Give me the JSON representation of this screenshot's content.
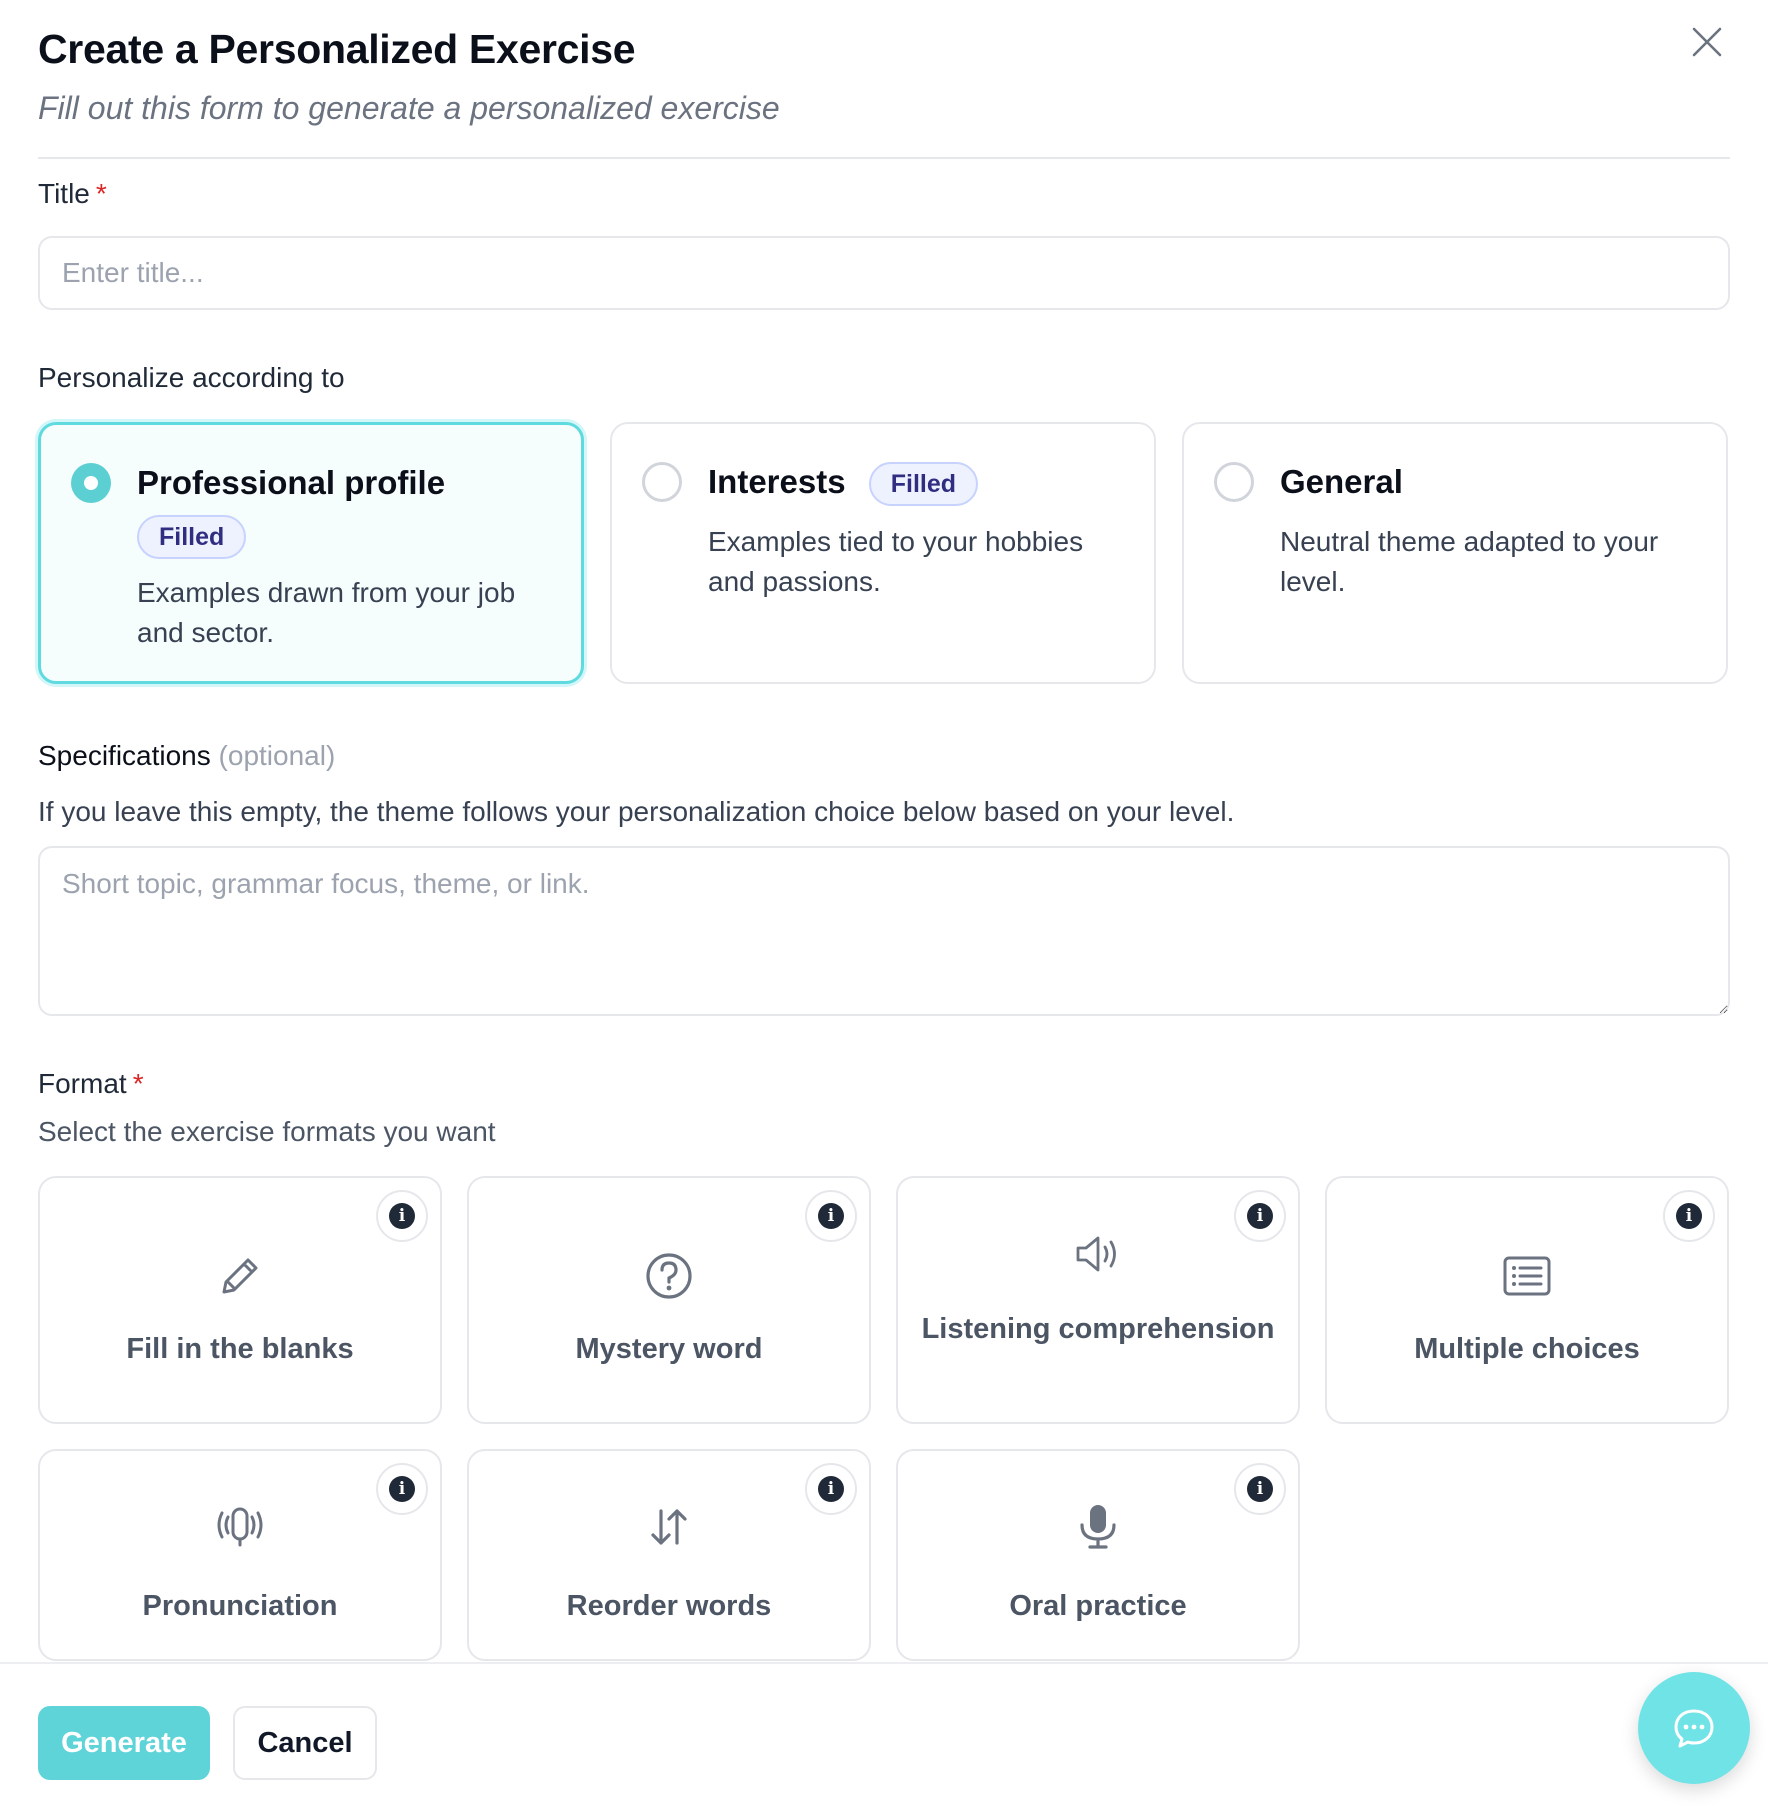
{
  "dialog": {
    "title": "Create a Personalized Exercise",
    "subtitle": "Fill out this form to generate a personalized exercise"
  },
  "title_field": {
    "label": "Title",
    "required_mark": "*",
    "placeholder": "Enter title...",
    "value": ""
  },
  "personalize": {
    "label": "Personalize according to",
    "selected": "Professional profile",
    "options": [
      {
        "title": "Professional profile",
        "badge": "Filled",
        "description": "Examples drawn from your job and sector."
      },
      {
        "title": "Interests",
        "badge": "Filled",
        "description": "Examples tied to your hobbies and passions."
      },
      {
        "title": "General",
        "badge": "",
        "description": "Neutral theme adapted to your level."
      }
    ]
  },
  "specifications": {
    "label": "Specifications",
    "optional": "(optional)",
    "help": "If you leave this empty, the theme follows your personalization choice below based on your level.",
    "placeholder": "Short topic, grammar focus, theme, or link.",
    "value": ""
  },
  "format": {
    "label": "Format",
    "required_mark": "*",
    "help": "Select the exercise formats you want",
    "info_glyph": "i",
    "options": [
      {
        "label": "Fill in the blanks",
        "icon": "pencil-icon"
      },
      {
        "label": "Mystery word",
        "icon": "question-circle-icon"
      },
      {
        "label": "Listening comprehension",
        "icon": "speaker-icon"
      },
      {
        "label": "Multiple choices",
        "icon": "list-icon"
      },
      {
        "label": "Pronunciation",
        "icon": "sound-waves-icon"
      },
      {
        "label": "Reorder words",
        "icon": "swap-vertical-icon"
      },
      {
        "label": "Oral practice",
        "icon": "microphone-icon"
      }
    ]
  },
  "footer": {
    "generate_label": "Generate",
    "cancel_label": "Cancel"
  },
  "colors": {
    "accent": "#5fd4d8",
    "selected_border": "#5fdbe0",
    "badge_text": "#312e81",
    "required": "#dc2626"
  }
}
